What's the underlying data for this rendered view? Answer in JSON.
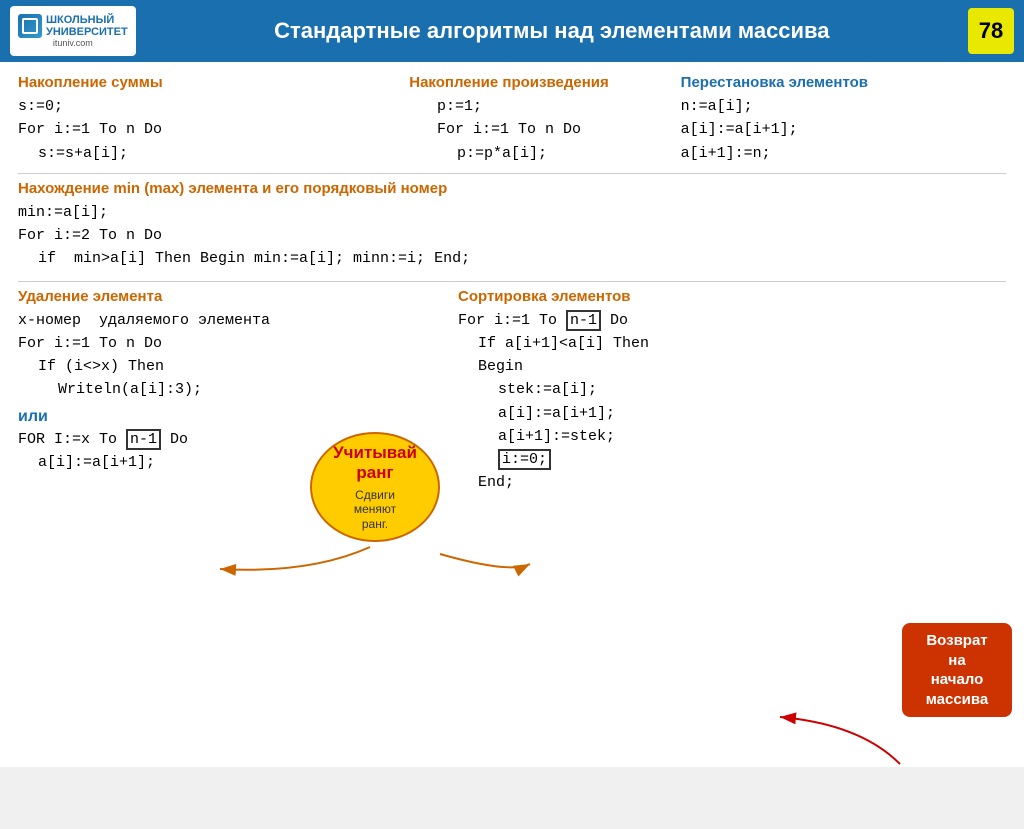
{
  "header": {
    "logo_line1": "Школьный",
    "logo_line2": "Университет",
    "logo_url_text": "ituniv.com",
    "title": "Стандартные алгоритмы над элементами массива",
    "page_number": "78"
  },
  "sections": {
    "sum_title": "Накопление суммы",
    "sum_code": [
      "s:=0;",
      "For i:=1 To n Do",
      " s:=s+a[i];"
    ],
    "prod_title": "Накопление произведения",
    "prod_code": [
      "p:=1;",
      "For i:=1 To n Do",
      " p:=p*a[i];"
    ],
    "swap_title": "Перестановка элементов",
    "swap_code": [
      "n:=a[i];",
      "a[i]:=a[i+1];",
      "a[i+1]:=n;"
    ],
    "minmax_title": "Нахождение  min (max) элемента и его порядковый номер",
    "minmax_code": [
      "min:=a[i];",
      "For i:=2 To n Do",
      " if  min>a[i] Then Begin min:=a[i]; minn:=i; End;"
    ],
    "del_title": "Удаление элемента",
    "del_code": [
      "x-номер  удаляемого элемента",
      "For i:=1 To n Do",
      " If (i<>x) Then",
      "  Writeln(a[i]:3);"
    ],
    "ili": "или",
    "del_code2": [
      "FOR I:=x To n-1 Do",
      " a[i]:=a[i+1];"
    ],
    "sort_title": "Сортировка элементов",
    "sort_code": [
      "For i:=1 To n-1 Do",
      " If a[i+1]<a[i] Then",
      " Begin",
      "   stek:=a[i];",
      "   a[i]:=a[i+1];",
      "   a[i+1]:=stek;",
      "   i:=0;",
      " End;"
    ],
    "callout_ucit": [
      "Учитывай",
      "ранг",
      "Сдвиги меняют ранг."
    ],
    "callout_vozvrat": [
      "Возврат на начало массива"
    ]
  }
}
